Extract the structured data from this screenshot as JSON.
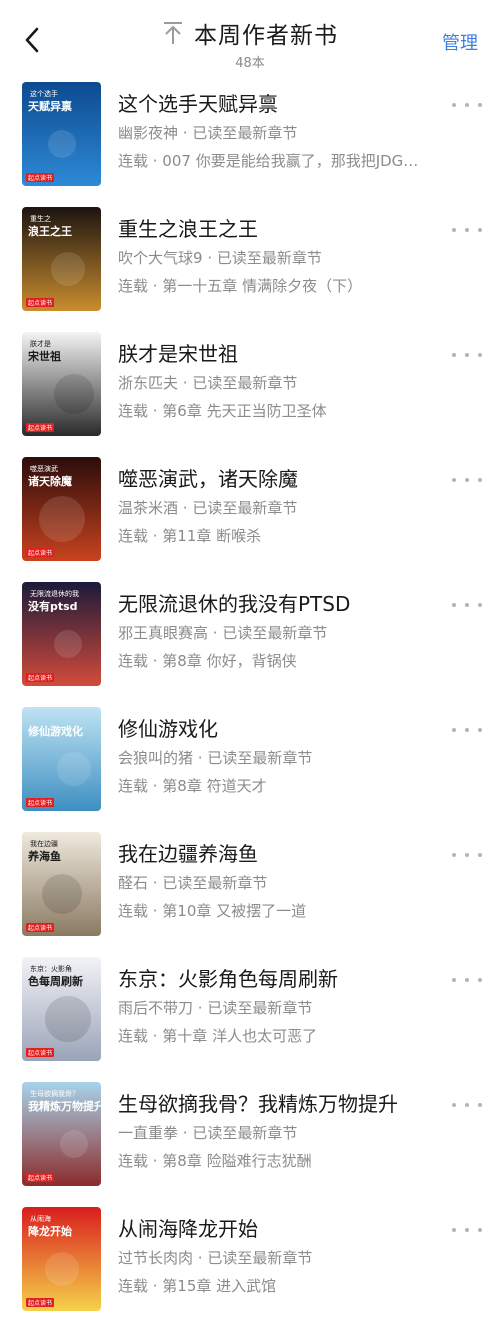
{
  "header": {
    "back_icon": "chevron-left-icon",
    "title_icon": "arrow-to-top-icon",
    "title": "本周作者新书",
    "count": "48本",
    "manage": "管理",
    "accent_color": "#3d7fe0"
  },
  "books": [
    {
      "title": "这个选手天赋异禀",
      "author": "幽影夜神",
      "status": "已读至最新章节",
      "chapter": "连载 · 007 你要是能给我赢了，那我把JDG…",
      "cover_text_small": "这个选手",
      "cover_text_big": "天赋异禀",
      "cover_colors": [
        "#0d4a8f",
        "#2d8ad6"
      ]
    },
    {
      "title": "重生之浪王之王",
      "author": "吹个大气球9",
      "status": "已读至最新章节",
      "chapter": "连载 · 第一十五章 情满除夕夜（下）",
      "cover_text_small": "重生之",
      "cover_text_big": "浪王之王",
      "cover_colors": [
        "#1c1410",
        "#c98d2e"
      ]
    },
    {
      "title": "朕才是宋世祖",
      "author": "浙东匹夫",
      "status": "已读至最新章节",
      "chapter": "连载 · 第6章 先天正当防卫圣体",
      "cover_text_small": "朕才是",
      "cover_text_big": "宋世祖",
      "cover_colors": [
        "#f4f4f4",
        "#2a2a2a"
      ]
    },
    {
      "title": "噬恶演武，诸天除魔",
      "author": "温茶米酒",
      "status": "已读至最新章节",
      "chapter": "连载 · 第11章 断喉杀",
      "cover_text_small": "噬恶演武",
      "cover_text_big": "诸天除魔",
      "cover_colors": [
        "#2b0c0c",
        "#c8431e"
      ]
    },
    {
      "title": "无限流退休的我没有PTSD",
      "author": "邪王真眼赛高",
      "status": "已读至最新章节",
      "chapter": "连载 · 第8章 你好，背锅侠",
      "cover_text_small": "无限流退休的我",
      "cover_text_big": "没有ptsd",
      "cover_colors": [
        "#1b1a3a",
        "#d34b3a"
      ]
    },
    {
      "title": "修仙游戏化",
      "author": "会狼叫的猪",
      "status": "已读至最新章节",
      "chapter": "连载 · 第8章 符道天才",
      "cover_text_small": "",
      "cover_text_big": "修仙游戏化",
      "cover_colors": [
        "#bfe3f2",
        "#3e8fc2"
      ]
    },
    {
      "title": "我在边疆养海鱼",
      "author": "醛石",
      "status": "已读至最新章节",
      "chapter": "连载 · 第10章 又被摆了一道",
      "cover_text_small": "我在边疆",
      "cover_text_big": "养海鱼",
      "cover_colors": [
        "#efe9de",
        "#8a7a62"
      ]
    },
    {
      "title": "东京：火影角色每周刷新",
      "author": "雨后不带刀",
      "status": "已读至最新章节",
      "chapter": "连载 · 第十章 洋人也太可恶了",
      "cover_text_small": "东京：火影角",
      "cover_text_big": "色每周刷新",
      "cover_colors": [
        "#f3f3f6",
        "#9aa3b8"
      ]
    },
    {
      "title": "生母欲摘我骨？我精炼万物提升",
      "author": "一直重拳",
      "status": "已读至最新章节",
      "chapter": "连载 · 第8章 险隘难行志犹酬",
      "cover_text_small": "生母欲摘我骨？",
      "cover_text_big": "我精炼万物提升",
      "cover_colors": [
        "#a8d3ea",
        "#8b2b2b"
      ]
    },
    {
      "title": "从闹海降龙开始",
      "author": "过节长肉肉",
      "status": "已读至最新章节",
      "chapter": "连载 · 第15章 进入武馆",
      "cover_text_small": "从闹海",
      "cover_text_big": "降龙开始",
      "cover_colors": [
        "#d91d1d",
        "#f5d24a"
      ]
    }
  ],
  "cover_badge": "起点读书",
  "meta_separator": " · "
}
